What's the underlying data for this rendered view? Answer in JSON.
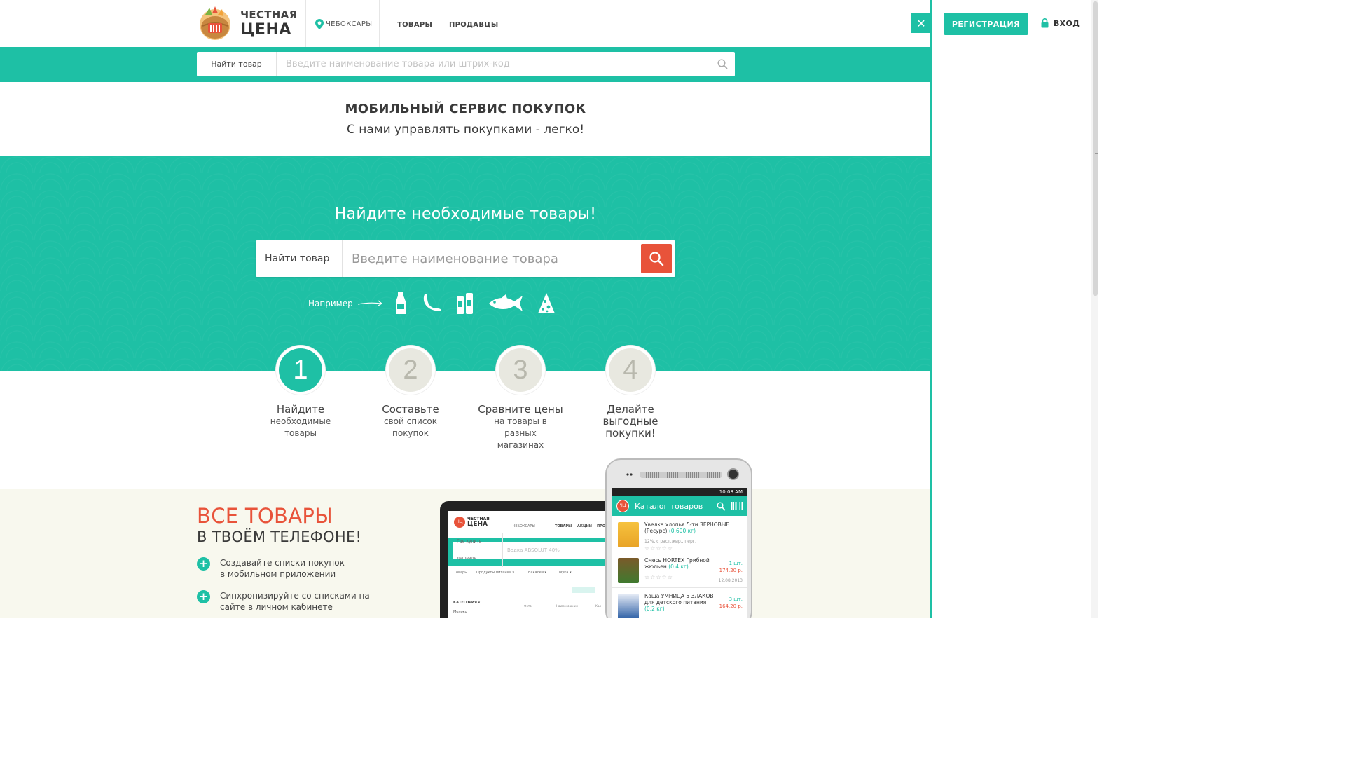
{
  "header": {
    "logo": {
      "line1": "ЧЕСТНАЯ",
      "line2": "ЦЕНА"
    },
    "city": "ЧЕБОКСАРЫ",
    "nav": [
      "ТОВАРЫ",
      "ПРОДАВЦЫ"
    ],
    "close_label": "✕"
  },
  "top_search": {
    "label": "Найти товар",
    "placeholder": "Введите наименование товара или штрих-код"
  },
  "promo": {
    "title": "МОБИЛЬНЫЙ СЕРВИС ПОКУПОК",
    "subtitle": "С нами управлять покупками - легко!"
  },
  "hero": {
    "title": "Найдите необходимые товары!",
    "search_label": "Найти товар",
    "search_placeholder": "Введите наименование товара",
    "examples_label": "Например",
    "example_icons": [
      "bottle-icon",
      "banana-icon",
      "drinks-icon",
      "fish-icon",
      "cheese-icon"
    ]
  },
  "steps": [
    {
      "number": "1",
      "title": "Найдите",
      "desc": "необходимые товары",
      "active": true
    },
    {
      "number": "2",
      "title": "Составьте",
      "desc": "свой список покупок",
      "active": false
    },
    {
      "number": "3",
      "title": "Сравните цены",
      "desc": "на товары в разных магазинах",
      "active": false
    },
    {
      "number": "4",
      "title": "Делайте выгодные покупки!",
      "desc": "",
      "active": false
    }
  ],
  "mobile": {
    "title1": "ВСЕ ТОВАРЫ",
    "title2": "В ТВОЁМ ТЕЛЕФОНЕ!",
    "features": [
      "Создавайте списки покупок в мобильном приложении",
      "Синхронизируйте со списками на сайте в личном кабинете"
    ]
  },
  "tablet": {
    "logo_mark": "ЧЦ",
    "logo_line1": "ЧЕСТНАЯ",
    "logo_line2": "ЦЕНА",
    "city": "ЧЕБОКСАРЫ",
    "nav": [
      "ТОВАРЫ",
      "АКЦИИ",
      "ПРО"
    ],
    "search_label": "Где купить дешевле",
    "search_value": "Водка ABSOLUT 40%",
    "categories": [
      "Товары",
      "Продукты питания ▾",
      "Бакалея ▾",
      "Мука ▾"
    ],
    "list_head": "КАТЕГОРИЯ ▾",
    "list_item": "Молоко",
    "columns": [
      "Фото",
      "Наименование",
      "Кол"
    ]
  },
  "phone": {
    "time": "10:08 AM",
    "app_mark": "ЧЦ",
    "app_title": "Каталог товаров",
    "items": [
      {
        "name": "Увелка хлопья 5-ти ЗЕРНОВЫЕ (Ресурс)",
        "weight": "(0.600 кг)",
        "meta": "12%, с раст.жир., перг.",
        "stars": "☆☆☆☆☆",
        "qty": "",
        "price": "",
        "date": ""
      },
      {
        "name": "Смесь HORTEX Грибной жюльен",
        "weight": "(0.4 кг)",
        "meta": "",
        "stars": "☆☆☆☆☆",
        "qty": "1 шт.",
        "price": "174.20 р.",
        "date": "12.08.2013"
      },
      {
        "name": "Каша УМНИЦА 5 ЗЛАКОВ для детского питания",
        "weight": "(0.2 кг)",
        "meta": "",
        "stars": "",
        "qty": "3 шт.",
        "price": "164.20 р.",
        "date": ""
      }
    ]
  },
  "panel": {
    "register_label": "РЕГИСТРАЦИЯ",
    "login_label": "ВХОД"
  },
  "colors": {
    "accent": "#1ec0a5",
    "brand_red": "#e8533a"
  }
}
